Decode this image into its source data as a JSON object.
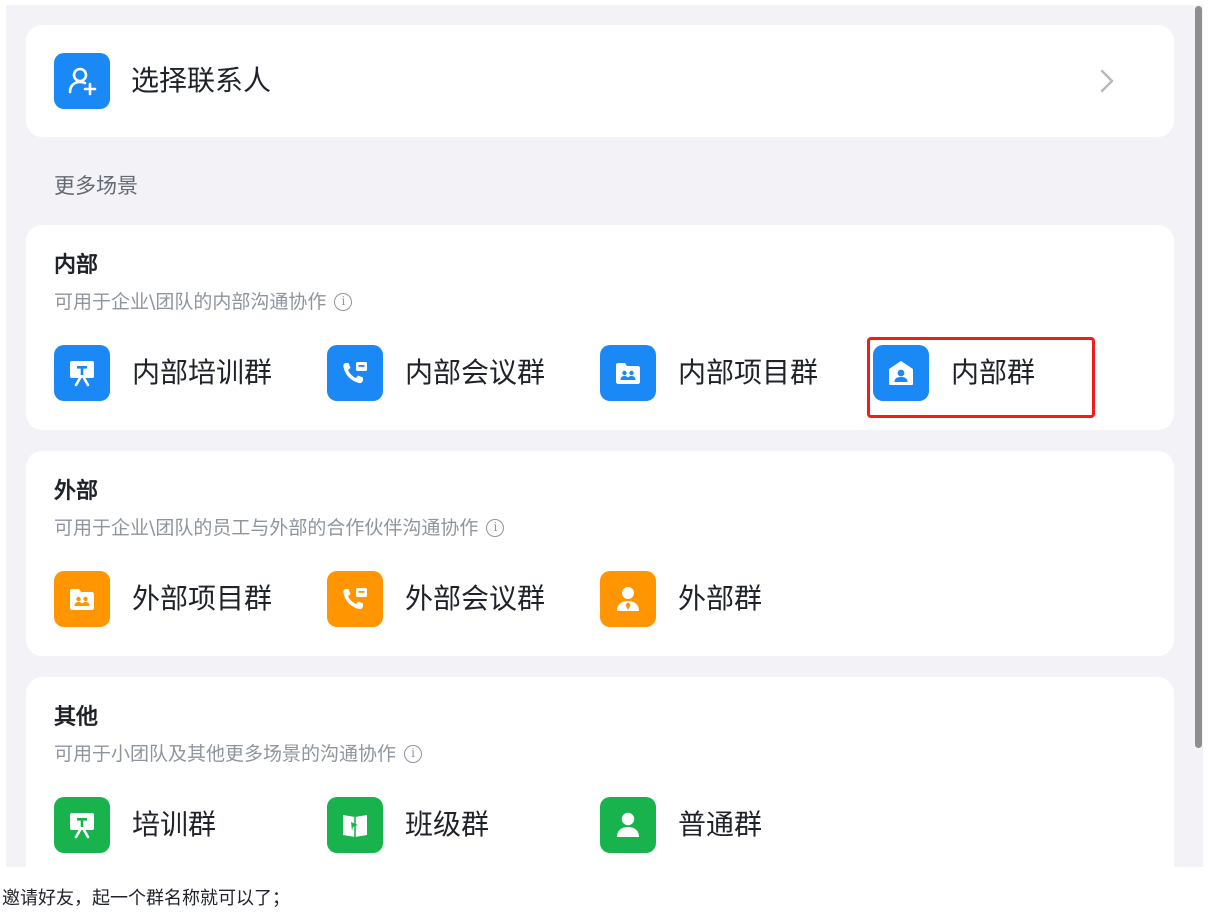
{
  "contact": {
    "label": "选择联系人"
  },
  "more_scenes": {
    "label": "更多场景"
  },
  "sections": {
    "internal": {
      "title": "内部",
      "desc": "可用于企业\\团队的内部沟通协作",
      "items": [
        "内部培训群",
        "内部会议群",
        "内部项目群",
        "内部群"
      ]
    },
    "external": {
      "title": "外部",
      "desc": "可用于企业\\团队的员工与外部的合作伙伴沟通协作",
      "items": [
        "外部项目群",
        "外部会议群",
        "外部群"
      ]
    },
    "other": {
      "title": "其他",
      "desc": "可用于小团队及其他更多场景的沟通协作",
      "items": [
        "培训群",
        "班级群",
        "普通群"
      ]
    }
  },
  "caption": "邀请好友，起一个群名称就可以了；",
  "colors": {
    "blue": "#1a89f5",
    "orange": "#ff9500",
    "green": "#19b34d",
    "highlight": "#f21c1c"
  },
  "icons": {
    "contact": "add-user-icon",
    "internal": [
      "training-board-icon",
      "meeting-phone-icon",
      "project-folder-icon",
      "house-user-icon"
    ],
    "external": [
      "project-folder-icon",
      "meeting-phone-icon",
      "user-badge-icon"
    ],
    "other": [
      "training-board-icon",
      "class-book-icon",
      "user-icon"
    ]
  }
}
